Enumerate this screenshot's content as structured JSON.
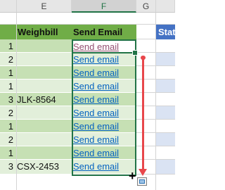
{
  "columns": [
    "E",
    "F",
    "G"
  ],
  "headers": {
    "weighbill": "Weighbill",
    "send_email": "Send Email",
    "status": "Stat"
  },
  "rows": [
    {
      "num": "1",
      "weighbill": "",
      "link": "Send email"
    },
    {
      "num": "2",
      "weighbill": "",
      "link": "Send email"
    },
    {
      "num": "1",
      "weighbill": "",
      "link": "Send email"
    },
    {
      "num": "1",
      "weighbill": "",
      "link": "Send email"
    },
    {
      "num": "3",
      "weighbill": "JLK-8564",
      "link": "Send email"
    },
    {
      "num": "2",
      "weighbill": "",
      "link": "Send email"
    },
    {
      "num": "1",
      "weighbill": "",
      "link": "Send email"
    },
    {
      "num": "2",
      "weighbill": "",
      "link": "Send email"
    },
    {
      "num": "1",
      "weighbill": "",
      "link": "Send email"
    },
    {
      "num": "3",
      "weighbill": "CSX-2453",
      "link": "Send email"
    }
  ],
  "colors": {
    "header_green": "#70ad47",
    "band_dark": "#c6e0b4",
    "band_light": "#e2efda",
    "hyperlink": "#0563c1",
    "visited_link": "#954f72",
    "selection": "#217346",
    "arrow": "#e8474b",
    "status_header": "#4472c4"
  },
  "icons": [
    "fill-handle-icon",
    "drag-arrow-icon",
    "crosshair-cursor-icon",
    "autofill-options-icon"
  ]
}
